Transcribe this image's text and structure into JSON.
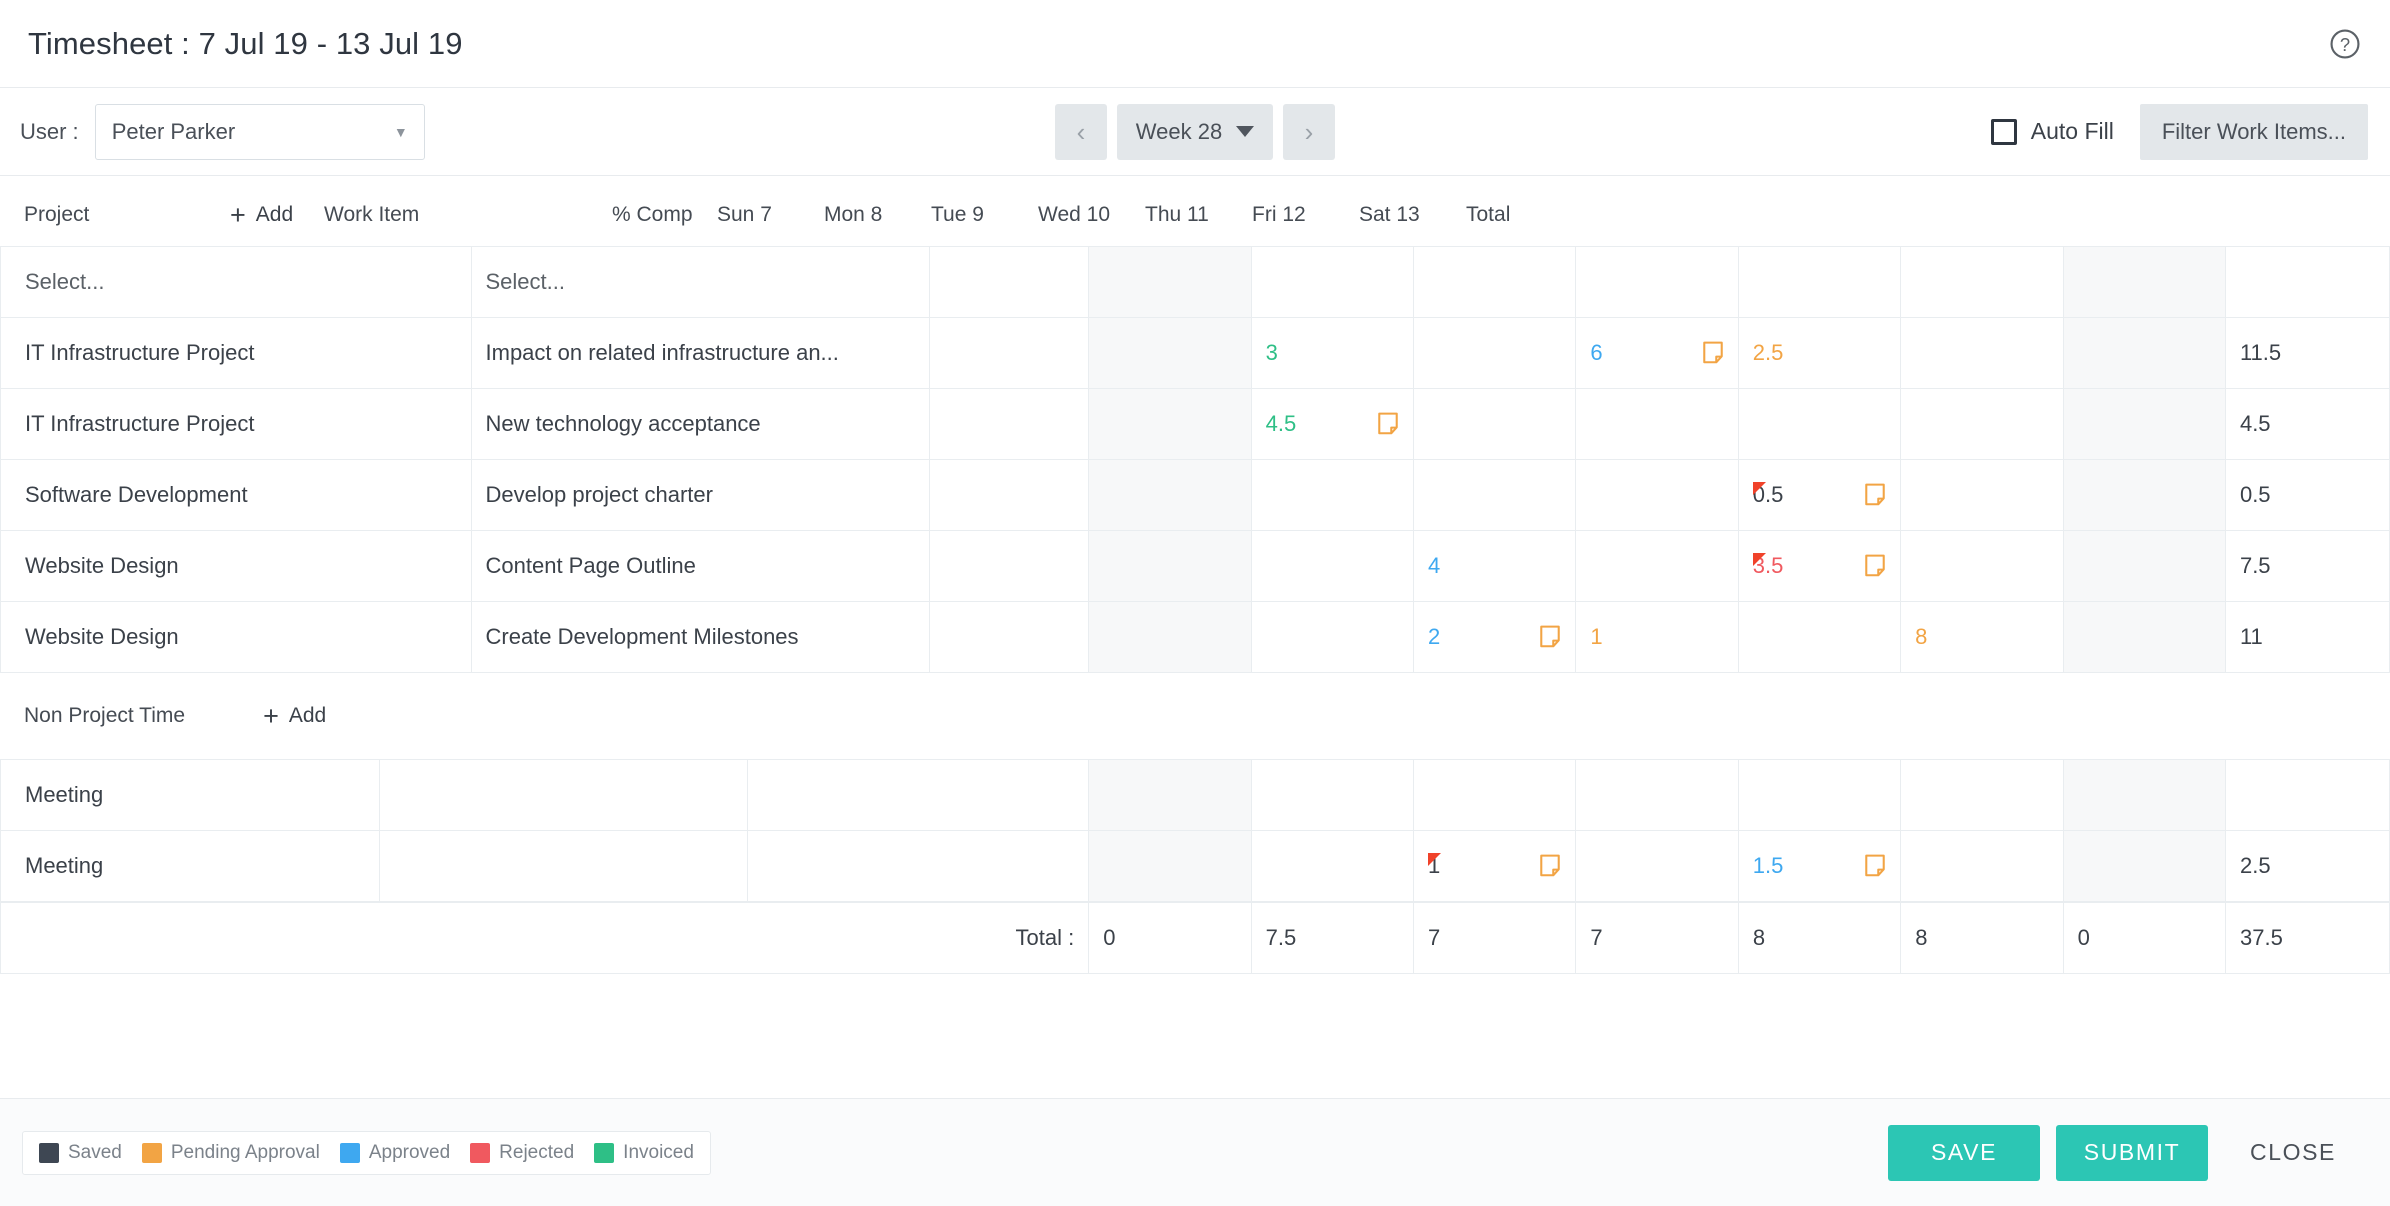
{
  "header": {
    "title": "Timesheet : 7 Jul 19 - 13 Jul 19",
    "help_icon": "help-circle-icon"
  },
  "toolbar": {
    "user_label": "User :",
    "user_value": "Peter Parker",
    "user_caret": "▼",
    "prev_label": "‹",
    "next_label": "›",
    "week_label": "Week 28",
    "autofill_label": "Auto Fill",
    "autofill_checked": false,
    "filter_label": "Filter Work Items..."
  },
  "grid": {
    "col_project": "Project",
    "col_add": "Add",
    "col_workitem": "Work Item",
    "col_comp": "% Comp",
    "col_total": "Total",
    "days": [
      "Sun 7",
      "Mon 8",
      "Tue 9",
      "Wed 10",
      "Thu 11",
      "Fri 12",
      "Sat 13"
    ],
    "weekend_index": [
      0,
      6
    ],
    "placeholder": "Select...",
    "rows": [
      {
        "project": "Select...",
        "workitem": "Select...",
        "comp": "",
        "placeholder_row": true,
        "days": [
          {
            "value": "",
            "status": "",
            "note": false,
            "corner": false
          },
          {
            "value": "",
            "status": "",
            "note": false,
            "corner": false
          },
          {
            "value": "",
            "status": "",
            "note": false,
            "corner": false
          },
          {
            "value": "",
            "status": "",
            "note": false,
            "corner": false
          },
          {
            "value": "",
            "status": "",
            "note": false,
            "corner": false
          },
          {
            "value": "",
            "status": "",
            "note": false,
            "corner": false
          },
          {
            "value": "",
            "status": "",
            "note": false,
            "corner": false
          }
        ],
        "total": ""
      },
      {
        "project": "IT Infrastructure Project",
        "workitem": "Impact on related infrastructure an...",
        "comp": "",
        "placeholder_row": false,
        "days": [
          {
            "value": "",
            "status": "",
            "note": false,
            "corner": false
          },
          {
            "value": "3",
            "status": "invoiced",
            "note": false,
            "corner": false
          },
          {
            "value": "",
            "status": "",
            "note": false,
            "corner": false
          },
          {
            "value": "6",
            "status": "approved",
            "note": true,
            "corner": false
          },
          {
            "value": "2.5",
            "status": "pending",
            "note": false,
            "corner": false
          },
          {
            "value": "",
            "status": "",
            "note": false,
            "corner": false
          },
          {
            "value": "",
            "status": "",
            "note": false,
            "corner": false
          }
        ],
        "total": "11.5"
      },
      {
        "project": "IT Infrastructure Project",
        "workitem": "New technology acceptance",
        "comp": "",
        "placeholder_row": false,
        "days": [
          {
            "value": "",
            "status": "",
            "note": false,
            "corner": false
          },
          {
            "value": "4.5",
            "status": "invoiced",
            "note": true,
            "corner": false
          },
          {
            "value": "",
            "status": "",
            "note": false,
            "corner": false
          },
          {
            "value": "",
            "status": "",
            "note": false,
            "corner": false
          },
          {
            "value": "",
            "status": "",
            "note": false,
            "corner": false
          },
          {
            "value": "",
            "status": "",
            "note": false,
            "corner": false
          },
          {
            "value": "",
            "status": "",
            "note": false,
            "corner": false
          }
        ],
        "total": "4.5"
      },
      {
        "project": "Software Development",
        "workitem": "Develop project charter",
        "comp": "",
        "placeholder_row": false,
        "days": [
          {
            "value": "",
            "status": "",
            "note": false,
            "corner": false
          },
          {
            "value": "",
            "status": "",
            "note": false,
            "corner": false
          },
          {
            "value": "",
            "status": "",
            "note": false,
            "corner": false
          },
          {
            "value": "",
            "status": "",
            "note": false,
            "corner": false
          },
          {
            "value": "0.5",
            "status": "saved",
            "note": true,
            "corner": true
          },
          {
            "value": "",
            "status": "",
            "note": false,
            "corner": false
          },
          {
            "value": "",
            "status": "",
            "note": false,
            "corner": false
          }
        ],
        "total": "0.5"
      },
      {
        "project": "Website Design",
        "workitem": "Content Page Outline",
        "comp": "",
        "placeholder_row": false,
        "days": [
          {
            "value": "",
            "status": "",
            "note": false,
            "corner": false
          },
          {
            "value": "",
            "status": "",
            "note": false,
            "corner": false
          },
          {
            "value": "4",
            "status": "approved",
            "note": false,
            "corner": false
          },
          {
            "value": "",
            "status": "",
            "note": false,
            "corner": false
          },
          {
            "value": "3.5",
            "status": "rejected",
            "note": true,
            "corner": true
          },
          {
            "value": "",
            "status": "",
            "note": false,
            "corner": false
          },
          {
            "value": "",
            "status": "",
            "note": false,
            "corner": false
          }
        ],
        "total": "7.5"
      },
      {
        "project": "Website Design",
        "workitem": "Create Development Milestones",
        "comp": "",
        "placeholder_row": false,
        "days": [
          {
            "value": "",
            "status": "",
            "note": false,
            "corner": false
          },
          {
            "value": "",
            "status": "",
            "note": false,
            "corner": false
          },
          {
            "value": "2",
            "status": "approved",
            "note": true,
            "corner": false
          },
          {
            "value": "1",
            "status": "pending",
            "note": false,
            "corner": false
          },
          {
            "value": "",
            "status": "",
            "note": false,
            "corner": false
          },
          {
            "value": "8",
            "status": "pending",
            "note": false,
            "corner": false
          },
          {
            "value": "",
            "status": "",
            "note": false,
            "corner": false
          }
        ],
        "total": "11"
      }
    ]
  },
  "non_project": {
    "title": "Non Project Time",
    "add_label": "Add",
    "rows": [
      {
        "name": "Meeting",
        "days": [
          {
            "value": "",
            "status": "",
            "note": false,
            "corner": false
          },
          {
            "value": "",
            "status": "",
            "note": false,
            "corner": false
          },
          {
            "value": "",
            "status": "",
            "note": false,
            "corner": false
          },
          {
            "value": "",
            "status": "",
            "note": false,
            "corner": false
          },
          {
            "value": "",
            "status": "",
            "note": false,
            "corner": false
          },
          {
            "value": "",
            "status": "",
            "note": false,
            "corner": false
          },
          {
            "value": "",
            "status": "",
            "note": false,
            "corner": false
          }
        ],
        "total": ""
      },
      {
        "name": "Meeting",
        "days": [
          {
            "value": "",
            "status": "",
            "note": false,
            "corner": false
          },
          {
            "value": "",
            "status": "",
            "note": false,
            "corner": false
          },
          {
            "value": "1",
            "status": "saved",
            "note": true,
            "corner": true
          },
          {
            "value": "",
            "status": "",
            "note": false,
            "corner": false
          },
          {
            "value": "1.5",
            "status": "approved",
            "note": true,
            "corner": false
          },
          {
            "value": "",
            "status": "",
            "note": false,
            "corner": false
          },
          {
            "value": "",
            "status": "",
            "note": false,
            "corner": false
          }
        ],
        "total": "2.5"
      }
    ]
  },
  "totals": {
    "label": "Total :",
    "days": [
      "0",
      "7.5",
      "7",
      "7",
      "8",
      "8",
      "0"
    ],
    "grand": "37.5"
  },
  "legend": {
    "items": [
      {
        "label": "Saved",
        "color": "#3e4753"
      },
      {
        "label": "Pending Approval",
        "color": "#f2a444"
      },
      {
        "label": "Approved",
        "color": "#3ea8f0"
      },
      {
        "label": "Rejected",
        "color": "#f0595f"
      },
      {
        "label": "Invoiced",
        "color": "#2ebf86"
      }
    ]
  },
  "footer": {
    "save_label": "SAVE",
    "submit_label": "SUBMIT",
    "close_label": "CLOSE",
    "accent": "#2cc6b4"
  }
}
